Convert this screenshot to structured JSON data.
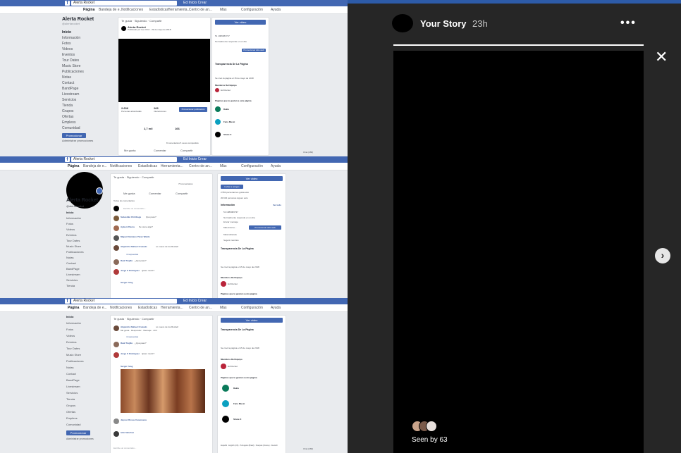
{
  "story": {
    "title": "Your Story",
    "time": "23h",
    "seen_by": "Seen by 63",
    "progress": 1.0,
    "more_glyph": "•••",
    "close_glyph": "✕",
    "next_glyph": "›"
  },
  "fb": {
    "search": "Alerta Rocket",
    "header_right": "Ed  Inicio  Crear",
    "tabs": {
      "page": "Página",
      "inbox": "Bandeja de e...",
      "notifications": "Notificaciones",
      "stats": "Estadísticas",
      "tools": "Herramienta...",
      "center": "Centro de an...",
      "more": "Más",
      "settings": "Configuración",
      "help": "Ayuda"
    },
    "page_name": "Alerta Rocket",
    "handle": "@alertarocket",
    "sidebar_items": [
      "Inicio",
      "Información",
      "Fotos",
      "Videos",
      "Eventos",
      "Tour Dates",
      "Music Store",
      "Publicaciones",
      "Notas",
      "Contact",
      "BandPage",
      "Livestream",
      "Servicios",
      "Tienda",
      "Grupos",
      "Ofertas",
      "Empleos",
      "Comunidad"
    ],
    "promote": "Promocionar",
    "manage_promos": "Administrar promociones",
    "post": {
      "actions": [
        "Te gusta",
        "Siguiendo",
        "Compartir"
      ],
      "author": "Alerta Rocket",
      "meta": "Publicado por Leo Ortiz · 29 de mayo de 2018",
      "reach": "2.636",
      "reach_label": "Personas alcanzadas",
      "engagement": "266",
      "engagement_label": "Interacciones",
      "boost": "Promocionar publicación",
      "views": "2,7 mil",
      "interactions": "166",
      "comments_shares": "8 comentarios  5 veces compartido",
      "like": "Me gusta",
      "comment": "Comentar",
      "share": "Compartir"
    },
    "comments": {
      "header": "Todos los comentarios",
      "count": "73 comentarios",
      "placeholder": "Escribe un comentario...",
      "items": [
        {
          "name": "Sebastián Chiriboga",
          "text": "Qué paso?"
        },
        {
          "name": "Ayleen Rivera",
          "text": "Se viene algo?"
        },
        {
          "name": "Miguel Damiano Pérez Waldo",
          "text": ""
        },
        {
          "name": "Alejandro Nahuel Cruzado",
          "text": "Lo nuevo de los Rocket!"
        },
        {
          "name": "Raúl Trujillo",
          "text": "¿Qué pasó?"
        },
        {
          "name": "Jorge F. Rodríguez",
          "text": "Quien murió?"
        },
        {
          "name": "Sergio Yang",
          "text": ""
        },
        {
          "name": "Jayson Rosas Casanueva",
          "text": ""
        },
        {
          "name": "Iván Sánchez",
          "text": ""
        }
      ],
      "reply_meta": "Me gusta · Responder · Mensaje · 23 h",
      "replies": "4 respuestas"
    },
    "right": {
      "cta": "Ver video",
      "see_all": "Ver todo",
      "invite": "Invitar a amigos",
      "likes": "2.554 personas les gusta esto",
      "follows": "20.632 personas siguen esto",
      "info_title": "Información",
      "phone": "51 1989083737",
      "response": "Normalmente responde en un día",
      "send_msg": "Enviar mensaje",
      "website": "Más-Interne...",
      "promote_site": "Promocionar sitio web",
      "genre": "Músico/banda",
      "suggest": "Sugerir cambios",
      "transparency": "Transparencia De La Página",
      "created": "Se creó la página el 15 de mayo de 2018",
      "team": "Miembros Del Equipo",
      "team_member": "Ed Rocket",
      "pages_liked": "Páginas que le gustan a esta página",
      "pages": [
        "Dakis",
        "Fans Music",
        "Shure X"
      ],
      "footer": "Español · English (US) · Português (Brasil) · Français (France) · Deutsch"
    },
    "chat": "Chat (466)"
  },
  "colors": {
    "fb_blue": "#4267b2",
    "bg": "#262626",
    "story_frame": "#000000"
  }
}
